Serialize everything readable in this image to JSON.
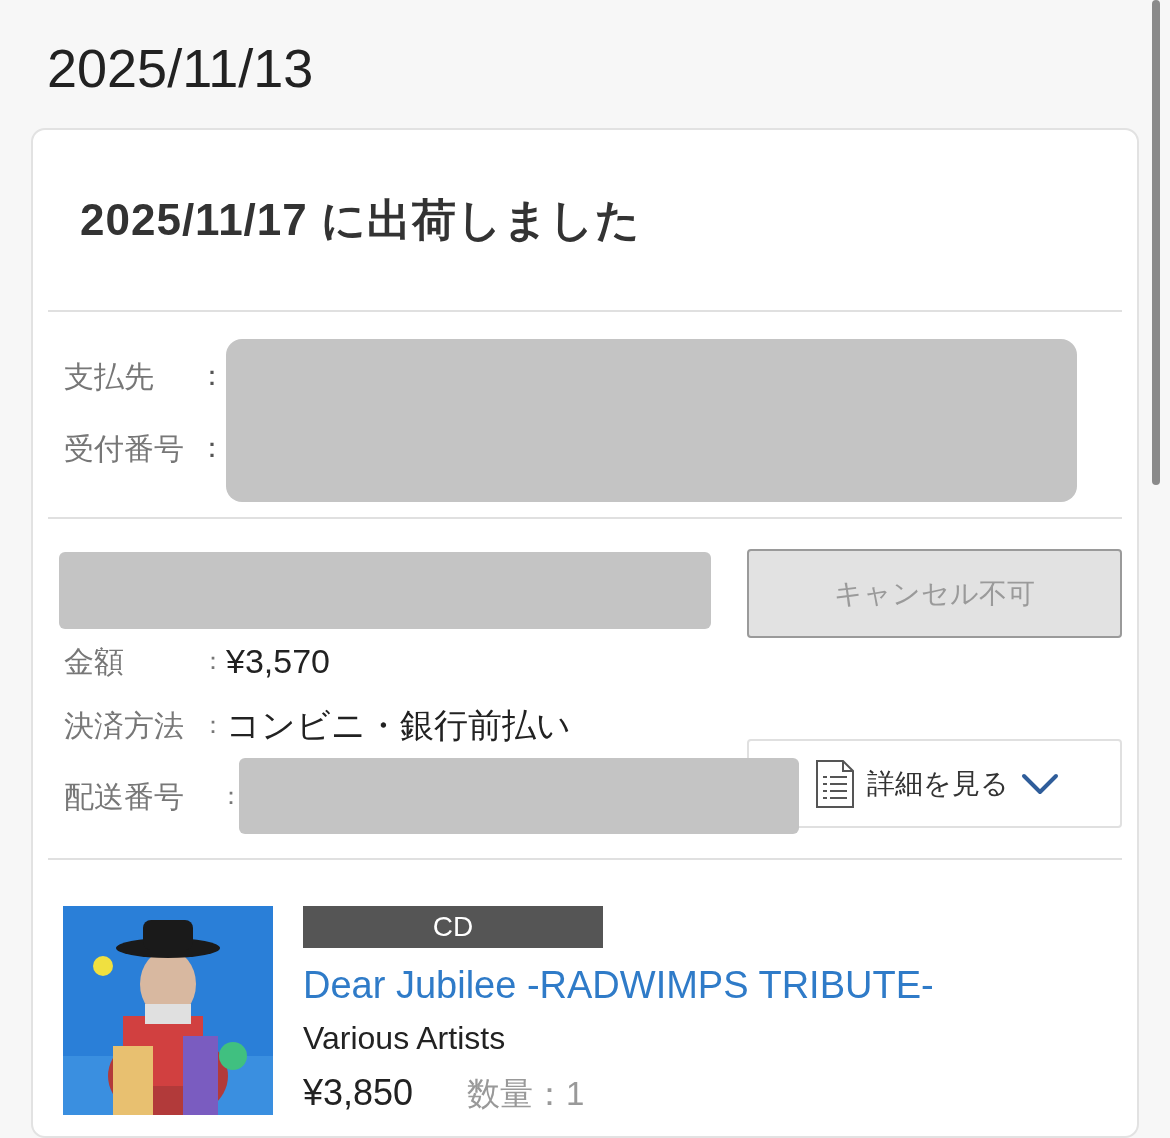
{
  "order_date": "2025/11/13",
  "shipping_status": "2025/11/17 に出荷しました",
  "payee_section": {
    "redacted": true,
    "fields": [
      {
        "label": "支払先",
        "separator": "："
      },
      {
        "label": "受付番号",
        "separator": "："
      }
    ]
  },
  "summary": {
    "redacted_bar": true,
    "fields": [
      {
        "label": "金額",
        "separator": "：",
        "value": "¥3,570",
        "redacted": false
      },
      {
        "label": "決済方法",
        "separator": "：",
        "value": "コンビニ・銀行前払い",
        "redacted": false
      },
      {
        "label": "配送番号",
        "separator": "：",
        "redacted": true
      }
    ],
    "cancel_button": {
      "label": "キャンセル不可",
      "disabled": true
    },
    "details_button": {
      "label": "詳細を見る",
      "expanded": false
    }
  },
  "item": {
    "format": "CD",
    "title": "Dear Jubilee -RADWIMPS TRIBUTE-",
    "artist": "Various Artists",
    "price": "¥3,850",
    "quantity": "数量：1"
  }
}
